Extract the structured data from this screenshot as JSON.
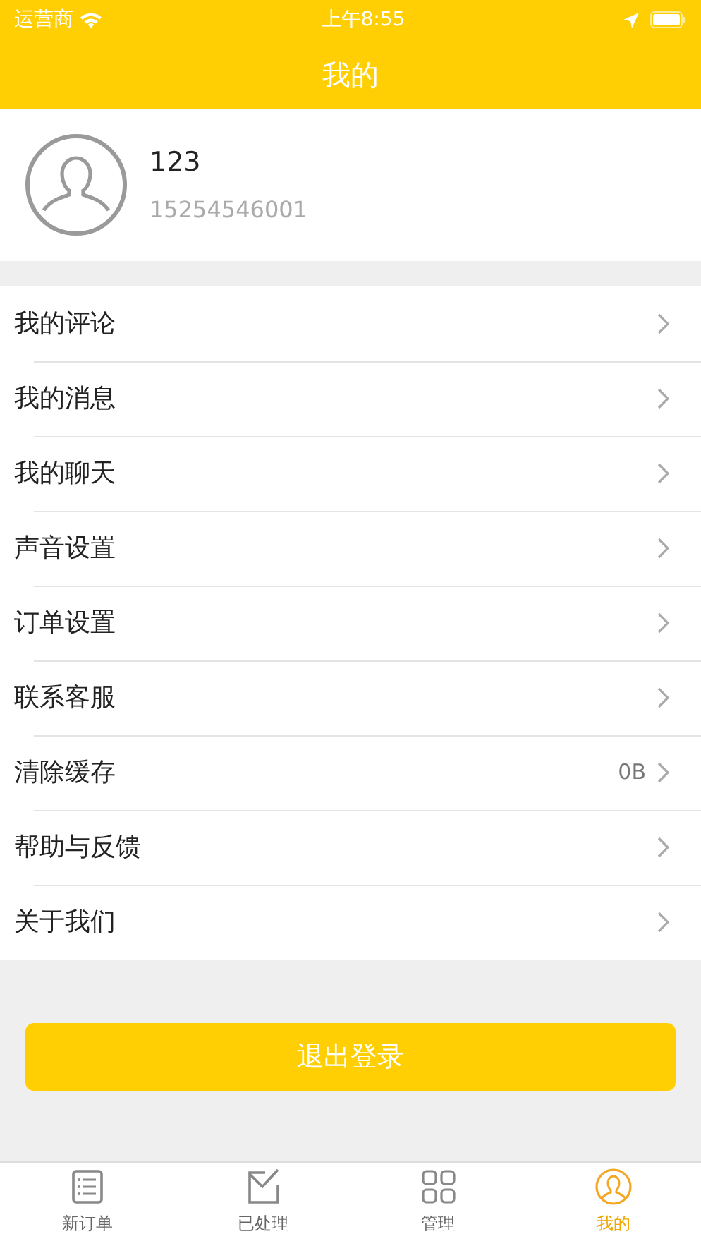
{
  "status_bar": {
    "carrier": "运营商",
    "time": "上午8:55"
  },
  "header": {
    "title": "我的"
  },
  "profile": {
    "name": "123",
    "phone": "15254546001"
  },
  "menu": [
    {
      "label": "我的评论"
    },
    {
      "label": "我的消息"
    },
    {
      "label": "我的聊天"
    },
    {
      "label": "声音设置"
    },
    {
      "label": "订单设置"
    },
    {
      "label": "联系客服"
    },
    {
      "label": "清除缓存",
      "value": "0B"
    },
    {
      "label": "帮助与反馈"
    },
    {
      "label": "关于我们"
    }
  ],
  "logout_button": "退出登录",
  "tab_bar": [
    {
      "label": "新订单",
      "kind": "list",
      "selected": false
    },
    {
      "label": "已处理",
      "kind": "done",
      "selected": false
    },
    {
      "label": "管理",
      "kind": "grid",
      "selected": false
    },
    {
      "label": "我的",
      "kind": "person",
      "selected": true
    }
  ]
}
